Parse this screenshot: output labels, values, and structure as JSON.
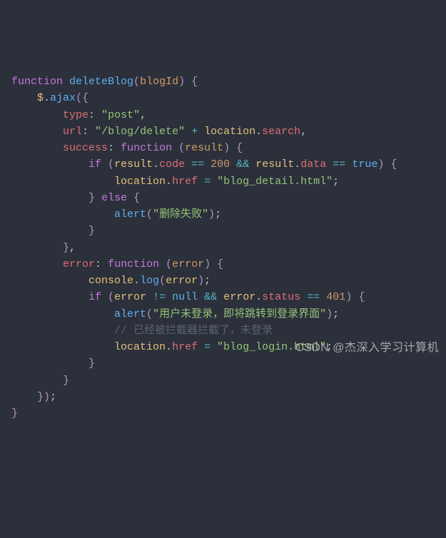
{
  "code": {
    "fn_kw": "function",
    "fn_name": "deleteBlog",
    "param": "blogId",
    "jq": "$",
    "ajax": "ajax",
    "type_key": "type",
    "type_val": "\"post\"",
    "url_key": "url",
    "url_val": "\"/blog/delete\"",
    "loc_obj": "location",
    "search_prop": "search",
    "success_key": "success",
    "kw_function": "function",
    "result_param": "result",
    "kw_if": "if",
    "result_code": "code",
    "num_200": "200",
    "op_and": "&&",
    "result_data": "data",
    "op_eq": "==",
    "kw_true": "true",
    "href_prop": "href",
    "blog_detail_str": "\"blog_detail.html\"",
    "kw_else": "else",
    "alert_fn": "alert",
    "alert_fail": "\"删除失败\"",
    "error_key": "error",
    "error_param": "error",
    "console_obj": "console",
    "log_fn": "log",
    "op_ne": "!=",
    "kw_null": "null",
    "status_prop": "status",
    "num_401": "401",
    "alert_login": "\"用户未登录，即将跳转到登录界面\"",
    "comment_line": "// 已经被拦截器拦截了，未登录",
    "blog_login_str": "\"blog_login.html\""
  },
  "watermark": "CSDN @杰深入学习计算机"
}
